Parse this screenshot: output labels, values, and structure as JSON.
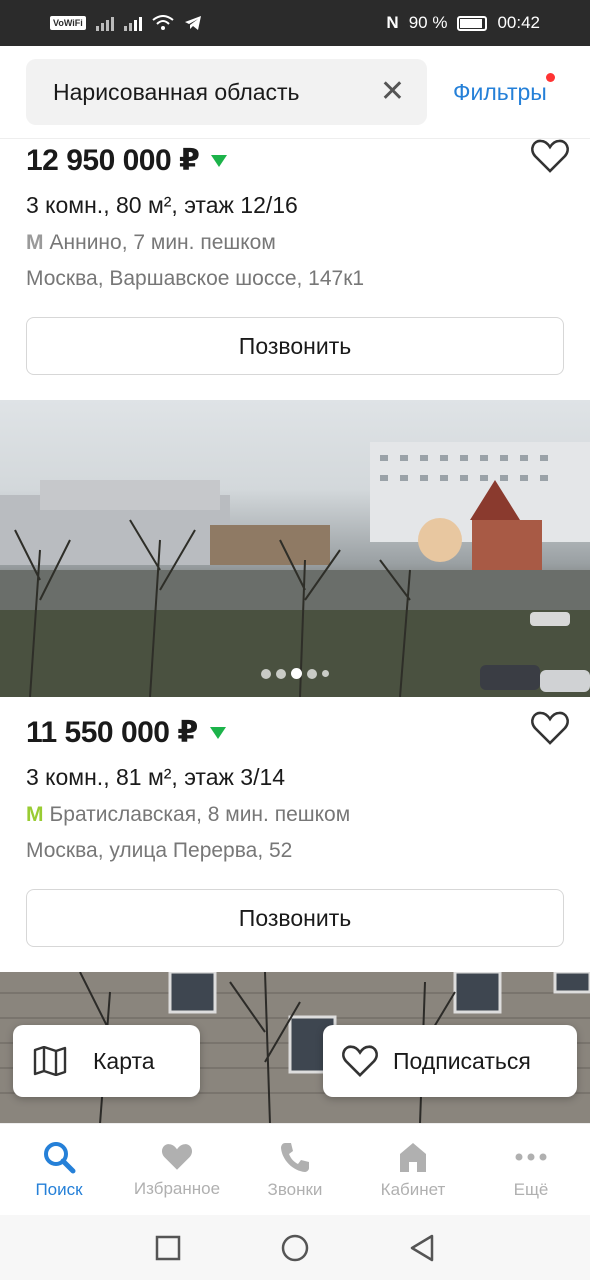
{
  "status_bar": {
    "vowifi": "VoWiFi",
    "battery": "90 %",
    "time": "00:42"
  },
  "search": {
    "query": "Нарисованная область",
    "filters_label": "Фильтры",
    "filters_dot_color": "#ff3333"
  },
  "listings": [
    {
      "price": "12 950 000 ₽",
      "details": "3 комн., 80 м², этаж 12/16",
      "metro": "Аннино, 7 мин. пешком",
      "metro_color": "#9a9a9a",
      "address": "Москва, Варшавское шоссе, 147к1",
      "call_label": "Позвонить"
    },
    {
      "price": "11 550 000 ₽",
      "details": "3 комн., 81 м², этаж 3/14",
      "metro": "Братиславская, 8 мин. пешком",
      "metro_color": "#99cc33",
      "address": "Москва, улица Перерва, 52",
      "call_label": "Позвонить"
    }
  ],
  "floating": {
    "map_label": "Карта",
    "subscribe_label": "Подписаться"
  },
  "bottom_nav": [
    {
      "label": "Поиск",
      "icon": "search-icon",
      "active": true
    },
    {
      "label": "Избранное",
      "icon": "heart-icon",
      "active": false
    },
    {
      "label": "Звонки",
      "icon": "phone-icon",
      "active": false
    },
    {
      "label": "Кабинет",
      "icon": "home-icon",
      "active": false
    },
    {
      "label": "Ещё",
      "icon": "more-icon",
      "active": false
    }
  ],
  "colors": {
    "accent": "#2580d8",
    "price_down": "#1cb34a"
  }
}
